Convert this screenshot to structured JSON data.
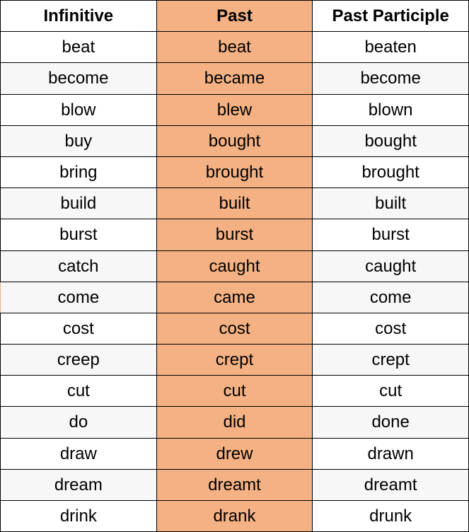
{
  "headers": {
    "infinitive": "Infinitive",
    "past": "Past",
    "participle": "Past Participle"
  },
  "rows": [
    {
      "inf": "beat",
      "past": "beat",
      "pp": "beaten",
      "alt": false
    },
    {
      "inf": "become",
      "past": "became",
      "pp": "become",
      "alt": true
    },
    {
      "inf": "blow",
      "past": "blew",
      "pp": "blown",
      "alt": false
    },
    {
      "inf": "buy",
      "past": "bought",
      "pp": "bought",
      "alt": true
    },
    {
      "inf": "bring",
      "past": "brought",
      "pp": "brought",
      "alt": false
    },
    {
      "inf": "build",
      "past": "built",
      "pp": "built",
      "alt": true
    },
    {
      "inf": "burst",
      "past": "burst",
      "pp": "burst",
      "alt": false
    },
    {
      "inf": "catch",
      "past": "caught",
      "pp": "caught",
      "alt": true
    },
    {
      "inf": "come",
      "past": "came",
      "pp": "come",
      "alt": true,
      "comeRow": true
    },
    {
      "inf": "cost",
      "past": "cost",
      "pp": "cost",
      "alt": false
    },
    {
      "inf": "creep",
      "past": "crept",
      "pp": "crept",
      "alt": true
    },
    {
      "inf": "cut",
      "past": "cut",
      "pp": "cut",
      "alt": false
    },
    {
      "inf": "do",
      "past": "did",
      "pp": "done",
      "alt": true
    },
    {
      "inf": "draw",
      "past": "drew",
      "pp": "drawn",
      "alt": false
    },
    {
      "inf": "dream",
      "past": "dreamt",
      "pp": "dreamt",
      "alt": true
    },
    {
      "inf": "drink",
      "past": "drank",
      "pp": "drunk",
      "alt": false
    }
  ]
}
